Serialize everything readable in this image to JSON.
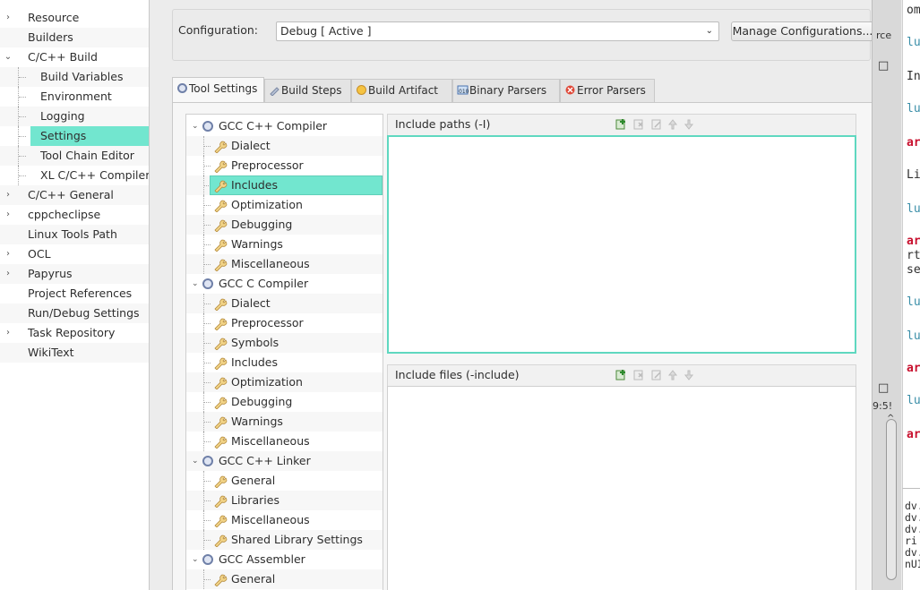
{
  "left_tree": [
    {
      "label": "Resource",
      "arrow": "›",
      "indent": 0
    },
    {
      "label": "Builders",
      "arrow": "",
      "indent": 0
    },
    {
      "label": "C/C++ Build",
      "arrow": "⌄",
      "indent": 0
    },
    {
      "label": "Build Variables",
      "arrow": "",
      "indent": 1
    },
    {
      "label": "Environment",
      "arrow": "",
      "indent": 1
    },
    {
      "label": "Logging",
      "arrow": "",
      "indent": 1
    },
    {
      "label": "Settings",
      "arrow": "",
      "indent": 1
    },
    {
      "label": "Tool Chain Editor",
      "arrow": "",
      "indent": 1
    },
    {
      "label": "XL C/C++ Compiler",
      "arrow": "",
      "indent": 1
    },
    {
      "label": "C/C++ General",
      "arrow": "›",
      "indent": 0
    },
    {
      "label": "cppcheclipse",
      "arrow": "›",
      "indent": 0
    },
    {
      "label": "Linux Tools Path",
      "arrow": "",
      "indent": 0
    },
    {
      "label": "OCL",
      "arrow": "›",
      "indent": 0
    },
    {
      "label": "Papyrus",
      "arrow": "›",
      "indent": 0
    },
    {
      "label": "Project References",
      "arrow": "",
      "indent": 0
    },
    {
      "label": "Run/Debug Settings",
      "arrow": "",
      "indent": 0
    },
    {
      "label": "Task Repository",
      "arrow": "›",
      "indent": 0
    },
    {
      "label": "WikiText",
      "arrow": "",
      "indent": 0
    }
  ],
  "config": {
    "label": "Configuration:",
    "value": "Debug  [ Active ]",
    "manage_button": "Manage Configurations..."
  },
  "tabs": [
    {
      "label": "Tool Settings",
      "icon": "tool-settings-icon"
    },
    {
      "label": "Build Steps",
      "icon": "build-steps-icon"
    },
    {
      "label": "Build Artifact",
      "icon": "build-artifact-icon"
    },
    {
      "label": "Binary Parsers",
      "icon": "binary-parsers-icon"
    },
    {
      "label": "Error Parsers",
      "icon": "error-parsers-icon"
    }
  ],
  "tool_tree": [
    {
      "label": "GCC C++ Compiler",
      "type": "tool"
    },
    {
      "label": "Dialect",
      "type": "option"
    },
    {
      "label": "Preprocessor",
      "type": "option"
    },
    {
      "label": "Includes",
      "type": "option"
    },
    {
      "label": "Optimization",
      "type": "option"
    },
    {
      "label": "Debugging",
      "type": "option"
    },
    {
      "label": "Warnings",
      "type": "option"
    },
    {
      "label": "Miscellaneous",
      "type": "option"
    },
    {
      "label": "GCC C Compiler",
      "type": "tool"
    },
    {
      "label": "Dialect",
      "type": "option"
    },
    {
      "label": "Preprocessor",
      "type": "option"
    },
    {
      "label": "Symbols",
      "type": "option"
    },
    {
      "label": "Includes",
      "type": "option"
    },
    {
      "label": "Optimization",
      "type": "option"
    },
    {
      "label": "Debugging",
      "type": "option"
    },
    {
      "label": "Warnings",
      "type": "option"
    },
    {
      "label": "Miscellaneous",
      "type": "option"
    },
    {
      "label": "GCC C++ Linker",
      "type": "tool"
    },
    {
      "label": "General",
      "type": "option"
    },
    {
      "label": "Libraries",
      "type": "option"
    },
    {
      "label": "Miscellaneous",
      "type": "option"
    },
    {
      "label": "Shared Library Settings",
      "type": "option"
    },
    {
      "label": "GCC Assembler",
      "type": "tool"
    },
    {
      "label": "General",
      "type": "option"
    }
  ],
  "include_paths": {
    "title": "Include paths (-I)"
  },
  "include_files": {
    "title": "Include files (-include)"
  },
  "background": {
    "gutter_top": "rce",
    "gutter_time": "9:5!",
    "code_lines": [
      {
        "text": "om",
        "style": "plain"
      },
      {
        "text": "lu",
        "style": "teal"
      },
      {
        "text": "In",
        "style": "plain"
      },
      {
        "text": "lu",
        "style": "teal"
      },
      {
        "text": "ar",
        "style": "red"
      },
      {
        "text": "Li",
        "style": "plain"
      },
      {
        "text": "lu",
        "style": "teal"
      },
      {
        "text": "ar",
        "style": "red"
      },
      {
        "text": "rt",
        "style": "plain"
      },
      {
        "text": "se",
        "style": "plain"
      },
      {
        "text": "lu",
        "style": "teal"
      },
      {
        "text": "lu",
        "style": "teal"
      },
      {
        "text": "ar",
        "style": "red"
      },
      {
        "text": "lu",
        "style": "teal"
      },
      {
        "text": "ar",
        "style": "red"
      }
    ],
    "console_lines": [
      "dv.",
      "dv.",
      "dv.",
      "ri",
      "dv.",
      "nUI"
    ]
  }
}
